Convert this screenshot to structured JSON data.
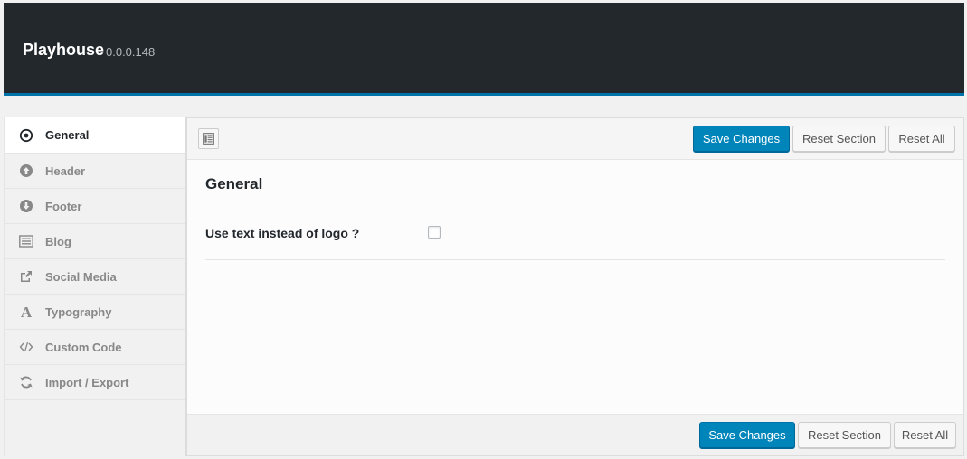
{
  "header": {
    "title": "Playhouse",
    "version": "0.0.0.148"
  },
  "colors": {
    "header_bg": "#23282d",
    "accent": "#0073aa",
    "primary_button": "#0085ba"
  },
  "sidebar": {
    "items": [
      {
        "label": "General",
        "icon": "target-circle-icon",
        "active": true
      },
      {
        "label": "Header",
        "icon": "arrow-up-circle-icon",
        "active": false
      },
      {
        "label": "Footer",
        "icon": "arrow-down-circle-icon",
        "active": false
      },
      {
        "label": "Blog",
        "icon": "list-panel-icon",
        "active": false
      },
      {
        "label": "Social Media",
        "icon": "share-box-icon",
        "active": false
      },
      {
        "label": "Typography",
        "icon": "letter-a-icon",
        "active": false
      },
      {
        "label": "Custom Code",
        "icon": "code-brackets-icon",
        "active": false
      },
      {
        "label": "Import / Export",
        "icon": "refresh-icon",
        "active": false
      }
    ]
  },
  "toolbar": {
    "save_label": "Save Changes",
    "reset_section_label": "Reset Section",
    "reset_all_label": "Reset All"
  },
  "content": {
    "section_title": "General",
    "fields": [
      {
        "label": "Use text instead of logo ?",
        "checked": false
      }
    ]
  }
}
